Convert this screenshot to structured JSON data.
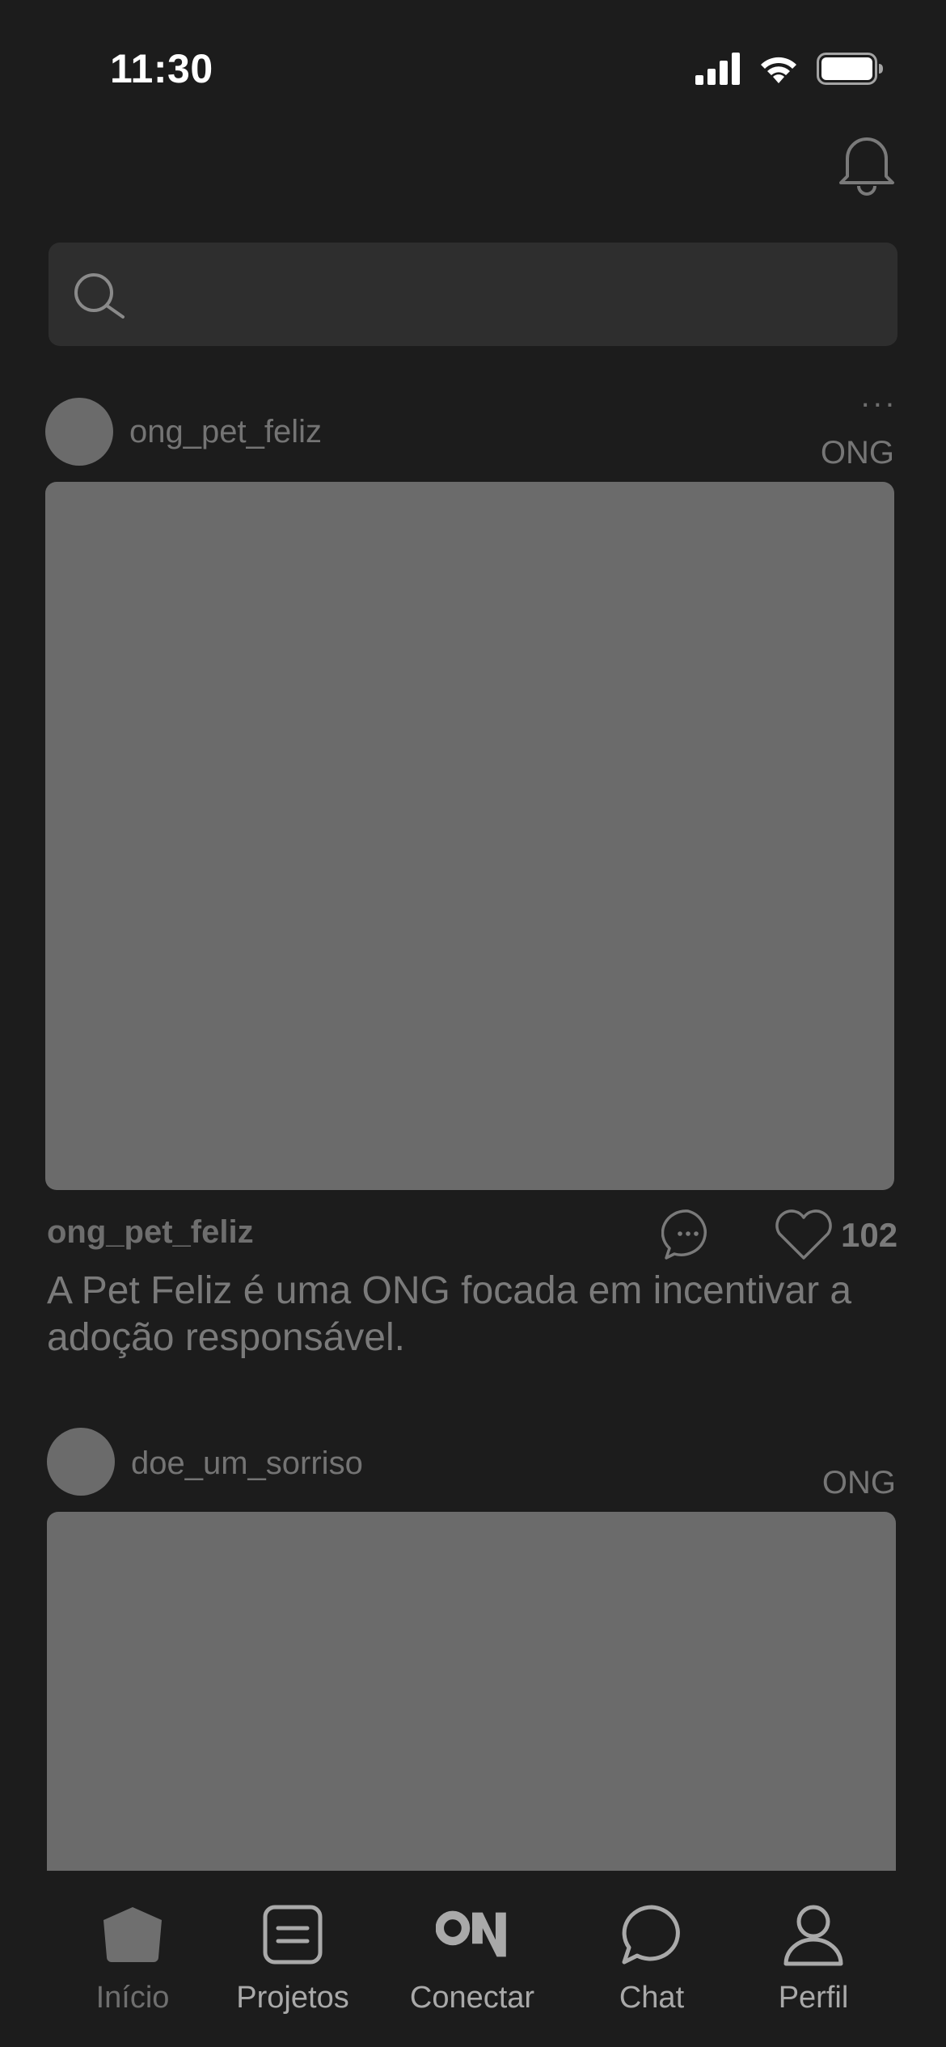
{
  "status_bar": {
    "time": "11:30"
  },
  "search": {
    "placeholder": "",
    "value": ""
  },
  "posts": [
    {
      "author": "ong_pet_feliz",
      "tag": "ONG",
      "more": "...",
      "caption_author": "ong_pet_feliz",
      "caption": "A Pet Feliz é uma ONG focada em incentivar a adoção responsável.",
      "likes": "102"
    },
    {
      "author": "doe_um_sorriso",
      "tag": "ONG"
    }
  ],
  "tabbar": {
    "items": [
      {
        "label": "Início",
        "icon": "home-icon",
        "active": true
      },
      {
        "label": "Projetos",
        "icon": "projects-icon",
        "active": false
      },
      {
        "label": "Conectar",
        "icon": "on-logo-icon",
        "active": false
      },
      {
        "label": "Chat",
        "icon": "chat-icon",
        "active": false
      },
      {
        "label": "Perfil",
        "icon": "profile-icon",
        "active": false
      }
    ]
  },
  "colors": {
    "background": "#1c1c1c",
    "surface": "#2e2e2e",
    "placeholder_gray": "#6b6b6b"
  }
}
